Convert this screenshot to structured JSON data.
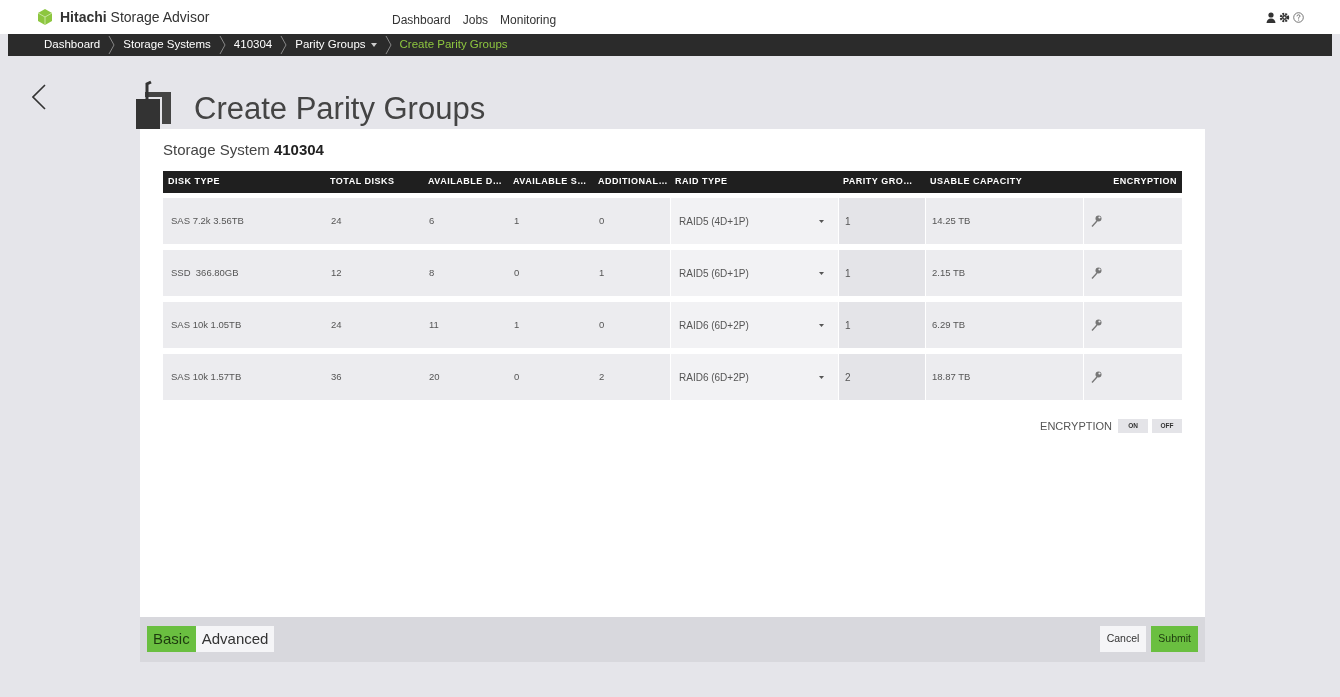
{
  "app": {
    "brand_bold": "Hitachi",
    "brand_rest": "Storage Advisor"
  },
  "nav": [
    "Dashboard",
    "Jobs",
    "Monitoring"
  ],
  "breadcrumbs": [
    {
      "label": "Dashboard",
      "current": false,
      "dropdown": false
    },
    {
      "label": "Storage Systems",
      "current": false,
      "dropdown": false
    },
    {
      "label": "410304",
      "current": false,
      "dropdown": false
    },
    {
      "label": "Parity Groups",
      "current": false,
      "dropdown": true
    },
    {
      "label": "Create Parity Groups",
      "current": true,
      "dropdown": false
    }
  ],
  "page_title": "Create Parity Groups",
  "storage_system": {
    "label": "Storage System",
    "value": "410304"
  },
  "table": {
    "columns": [
      "DISK TYPE",
      "TOTAL DISKS",
      "AVAILABLE D…",
      "AVAILABLE S…",
      "ADDITIONAL…",
      "RAID TYPE",
      "PARITY GRO…",
      "USABLE CAPACITY",
      "ENCRYPTION"
    ],
    "rows": [
      {
        "disk_type": "SAS 7.2k 3.56TB",
        "total_disks": "24",
        "available_d": "6",
        "available_s": "1",
        "additional": "0",
        "raid_type": "RAID5 (4D+1P)",
        "parity_groups": "1",
        "usable_capacity": "14.25 TB"
      },
      {
        "disk_type": "SSD  366.80GB",
        "total_disks": "12",
        "available_d": "8",
        "available_s": "0",
        "additional": "1",
        "raid_type": "RAID5 (6D+1P)",
        "parity_groups": "1",
        "usable_capacity": "2.15 TB"
      },
      {
        "disk_type": "SAS 10k 1.05TB",
        "total_disks": "24",
        "available_d": "11",
        "available_s": "1",
        "additional": "0",
        "raid_type": "RAID6 (6D+2P)",
        "parity_groups": "1",
        "usable_capacity": "6.29 TB"
      },
      {
        "disk_type": "SAS 10k 1.57TB",
        "total_disks": "36",
        "available_d": "20",
        "available_s": "0",
        "additional": "2",
        "raid_type": "RAID6 (6D+2P)",
        "parity_groups": "2",
        "usable_capacity": "18.87 TB"
      }
    ]
  },
  "encryption_toggle": {
    "label": "ENCRYPTION",
    "options": [
      "ON",
      "OFF"
    ]
  },
  "mode_tabs": [
    {
      "label": "Basic",
      "selected": true
    },
    {
      "label": "Advanced",
      "selected": false
    }
  ],
  "buttons": [
    {
      "label": "Cancel",
      "kind": "secondary"
    },
    {
      "label": "Submit",
      "kind": "primary"
    }
  ]
}
